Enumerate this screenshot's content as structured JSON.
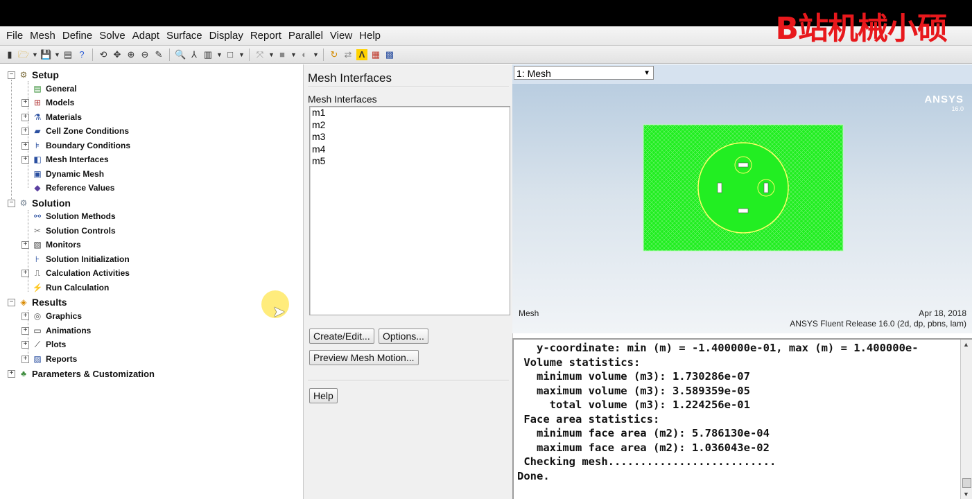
{
  "watermark": "B站机械小硕",
  "menu": [
    "File",
    "Mesh",
    "Define",
    "Solve",
    "Adapt",
    "Surface",
    "Display",
    "Report",
    "Parallel",
    "View",
    "Help"
  ],
  "tree": {
    "setup": {
      "label": "Setup",
      "items": [
        "General",
        "Models",
        "Materials",
        "Cell Zone Conditions",
        "Boundary Conditions",
        "Mesh Interfaces",
        "Dynamic Mesh",
        "Reference Values"
      ]
    },
    "solution": {
      "label": "Solution",
      "items": [
        "Solution Methods",
        "Solution Controls",
        "Monitors",
        "Solution Initialization",
        "Calculation Activities",
        "Run Calculation"
      ]
    },
    "results": {
      "label": "Results",
      "items": [
        "Graphics",
        "Animations",
        "Plots",
        "Reports"
      ]
    },
    "params": "Parameters & Customization"
  },
  "task": {
    "title": "Mesh Interfaces",
    "list_label": "Mesh Interfaces",
    "items": [
      "m1",
      "m2",
      "m3",
      "m4",
      "m5"
    ],
    "create_edit": "Create/Edit...",
    "options": "Options...",
    "preview": "Preview Mesh Motion...",
    "help": "Help"
  },
  "graphics": {
    "window_select": "1: Mesh",
    "logo": "ANSYS",
    "logo_version": "16.0",
    "caption": "Mesh",
    "date": "Apr 18, 2018",
    "release": "ANSYS Fluent Release 16.0 (2d, dp, pbns, lam)",
    "mesh_color": "#22ee22"
  },
  "console": {
    "lines": [
      "   y-coordinate: min (m) = -1.400000e-01, max (m) = 1.400000e-",
      " Volume statistics:",
      "   minimum volume (m3): 1.730286e-07",
      "   maximum volume (m3): 3.589359e-05",
      "     total volume (m3): 1.224256e-01",
      " Face area statistics:",
      "   minimum face area (m2): 5.786130e-04",
      "   maximum face area (m2): 1.036043e-02",
      " Checking mesh..........................",
      "Done."
    ]
  }
}
